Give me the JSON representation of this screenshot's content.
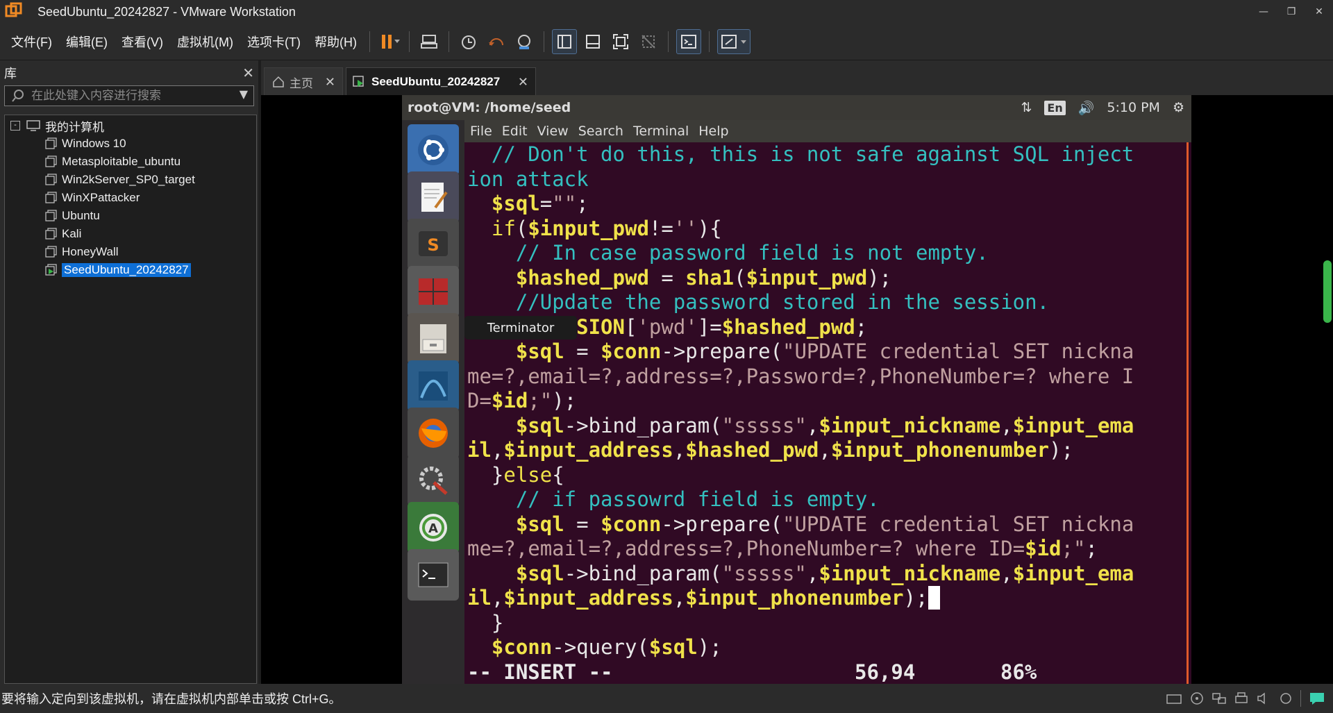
{
  "window": {
    "title": "SeedUbuntu_20242827 - VMware Workstation",
    "controls": [
      "minimize",
      "restore",
      "close"
    ]
  },
  "menu": [
    "文件(F)",
    "编辑(E)",
    "查看(V)",
    "虚拟机(M)",
    "选项卡(T)",
    "帮助(H)"
  ],
  "library": {
    "title": "库",
    "search_placeholder": "在此处键入内容进行搜索",
    "root": "我的计算机",
    "vms": [
      "Windows 10",
      "Metasploitable_ubuntu",
      "Win2kServer_SP0_target",
      "WinXPattacker",
      "Ubuntu",
      "Kali",
      "HoneyWall",
      "SeedUbuntu_20242827"
    ],
    "selected": "SeedUbuntu_20242827"
  },
  "tabs": {
    "home": "主页",
    "vm": "SeedUbuntu_20242827"
  },
  "guest": {
    "title": "root@VM: /home/seed",
    "lang": "En",
    "time": "5:10 PM",
    "terminal_menu": [
      "File",
      "Edit",
      "View",
      "Search",
      "Terminal",
      "Help"
    ],
    "tooltip": "Terminator"
  },
  "terminal": {
    "lines": [
      [
        [
          "cm",
          "  // Don't do this, this is not safe against SQL inject"
        ]
      ],
      [
        [
          "cm",
          "ion attack"
        ]
      ],
      [
        [
          "ar",
          "  "
        ],
        [
          "va",
          "$sql"
        ],
        [
          "ar",
          "="
        ],
        [
          "st",
          "\"\""
        ],
        [
          "ar",
          ";"
        ]
      ],
      [
        [
          "ar",
          "  "
        ],
        [
          "kw",
          "if"
        ],
        [
          "ar",
          "("
        ],
        [
          "va",
          "$input_pwd"
        ],
        [
          "ar",
          "!="
        ],
        [
          "st",
          "''"
        ],
        [
          "ar",
          "){"
        ]
      ],
      [
        [
          "cm",
          "    // In case password field is not empty."
        ]
      ],
      [
        [
          "ar",
          "    "
        ],
        [
          "va",
          "$hashed_pwd"
        ],
        [
          "ar",
          " = "
        ],
        [
          "fn",
          "sha1"
        ],
        [
          "ar",
          "("
        ],
        [
          "va",
          "$input_pwd"
        ],
        [
          "ar",
          ");"
        ]
      ],
      [
        [
          "cm",
          "    //Update the password stored in the session."
        ]
      ],
      [
        [
          "ar",
          "    "
        ],
        [
          "va",
          "$_SESSION"
        ],
        [
          "ar",
          "["
        ],
        [
          "st",
          "'pwd'"
        ],
        [
          "ar",
          "]="
        ],
        [
          "va",
          "$hashed_pwd"
        ],
        [
          "ar",
          ";"
        ]
      ],
      [
        [
          "ar",
          "    "
        ],
        [
          "va",
          "$sql"
        ],
        [
          "ar",
          " = "
        ],
        [
          "va",
          "$conn"
        ],
        [
          "ar",
          "->prepare("
        ],
        [
          "st",
          "\"UPDATE credential SET nickna"
        ]
      ],
      [
        [
          "st",
          "me=?,email=?,address=?,Password=?,PhoneNumber=? where I"
        ]
      ],
      [
        [
          "st",
          "D="
        ],
        [
          "va",
          "$id"
        ],
        [
          "st",
          ";\""
        ],
        [
          "ar",
          ");"
        ]
      ],
      [
        [
          "ar",
          "    "
        ],
        [
          "va",
          "$sql"
        ],
        [
          "ar",
          "->bind_param("
        ],
        [
          "st",
          "\"sssss\""
        ],
        [
          "ar",
          ","
        ],
        [
          "va",
          "$input_nickname"
        ],
        [
          "ar",
          ","
        ],
        [
          "va",
          "$input_ema"
        ]
      ],
      [
        [
          "va",
          "il"
        ],
        [
          "ar",
          ","
        ],
        [
          "va",
          "$input_address"
        ],
        [
          "ar",
          ","
        ],
        [
          "va",
          "$hashed_pwd"
        ],
        [
          "ar",
          ","
        ],
        [
          "va",
          "$input_phonenumber"
        ],
        [
          "ar",
          ");"
        ]
      ],
      [
        [
          "ar",
          "  }"
        ],
        [
          "kw",
          "else"
        ],
        [
          "ar",
          "{"
        ]
      ],
      [
        [
          "cm",
          "    // if passowrd field is empty."
        ]
      ],
      [
        [
          "ar",
          "    "
        ],
        [
          "va",
          "$sql"
        ],
        [
          "ar",
          " = "
        ],
        [
          "va",
          "$conn"
        ],
        [
          "ar",
          "->prepare("
        ],
        [
          "st",
          "\"UPDATE credential SET nickna"
        ]
      ],
      [
        [
          "st",
          "me=?,email=?,address=?,PhoneNumber=? where ID="
        ],
        [
          "va",
          "$id"
        ],
        [
          "st",
          ";\""
        ],
        [
          "ar",
          ";"
        ]
      ],
      [
        [
          "ar",
          "    "
        ],
        [
          "va",
          "$sql"
        ],
        [
          "ar",
          "->bind_param("
        ],
        [
          "st",
          "\"sssss\""
        ],
        [
          "ar",
          ","
        ],
        [
          "va",
          "$input_nickname"
        ],
        [
          "ar",
          ","
        ],
        [
          "va",
          "$input_ema"
        ]
      ],
      [
        [
          "va",
          "il"
        ],
        [
          "ar",
          ","
        ],
        [
          "va",
          "$input_address"
        ],
        [
          "ar",
          ","
        ],
        [
          "va",
          "$input_phonenumber"
        ],
        [
          "ar",
          ");"
        ],
        [
          "cursor",
          " "
        ]
      ],
      [
        [
          "ar",
          "  }"
        ]
      ],
      [
        [
          "ar",
          "  "
        ],
        [
          "va",
          "$conn"
        ],
        [
          "ar",
          "->query("
        ],
        [
          "va",
          "$sql"
        ],
        [
          "ar",
          ");"
        ]
      ]
    ],
    "mode": "-- INSERT --",
    "position": "56,94",
    "percent": "86%"
  },
  "statusbar": {
    "message": "要将输入定向到该虚拟机，请在虚拟机内部单击或按 Ctrl+G。"
  }
}
